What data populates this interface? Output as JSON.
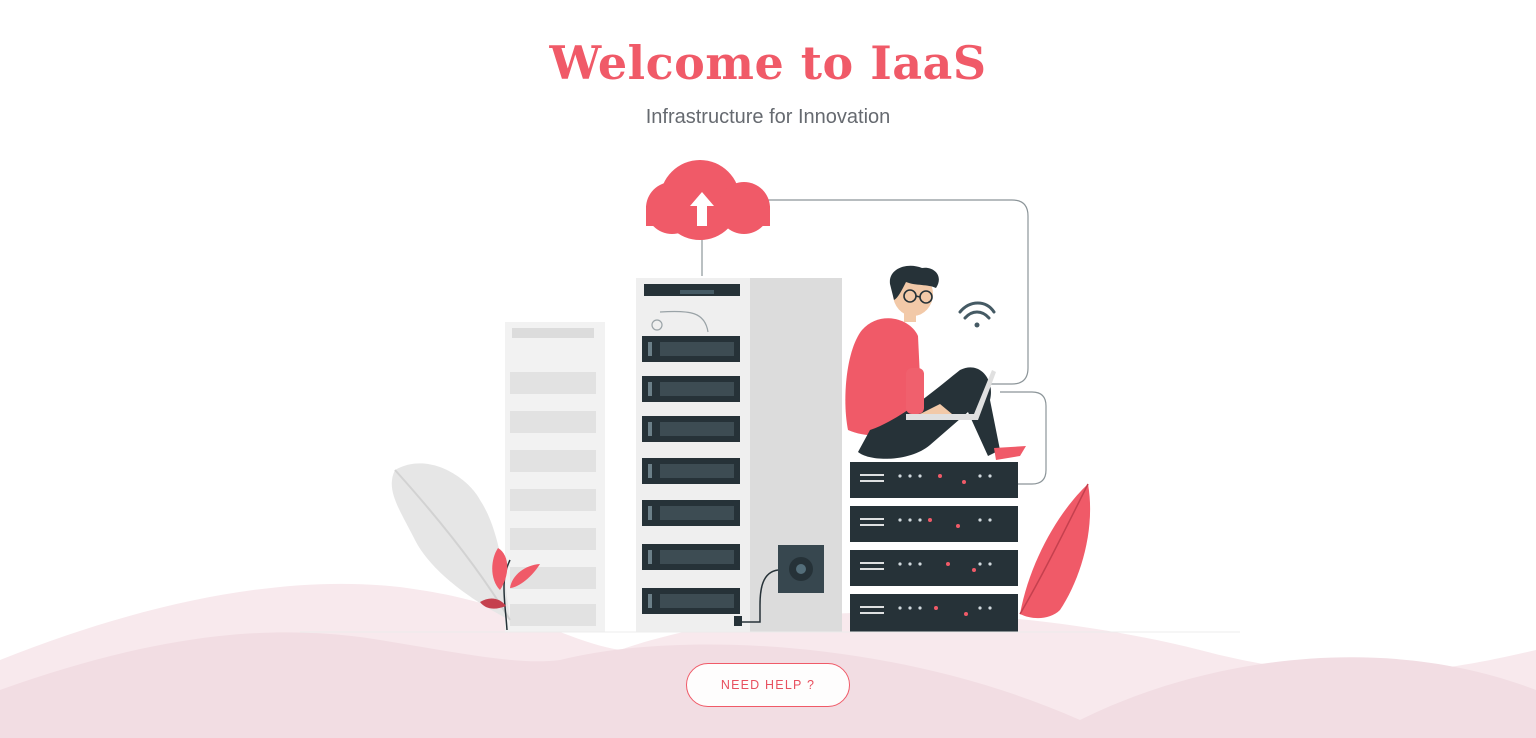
{
  "hero": {
    "title": "Welcome to IaaS",
    "subtitle": "Infrastructure for Innovation"
  },
  "illustration": {
    "items": [
      "cloud-upload-icon",
      "server-rack",
      "person-with-laptop",
      "wifi-icon",
      "server-stack",
      "leaf-plant"
    ]
  },
  "actions": {
    "help_label": "NEED HELP ?"
  },
  "colors": {
    "accent": "#f05a68",
    "dark": "#263238",
    "wave_light": "#f8e9ed",
    "wave_dark": "#f2dde3"
  }
}
